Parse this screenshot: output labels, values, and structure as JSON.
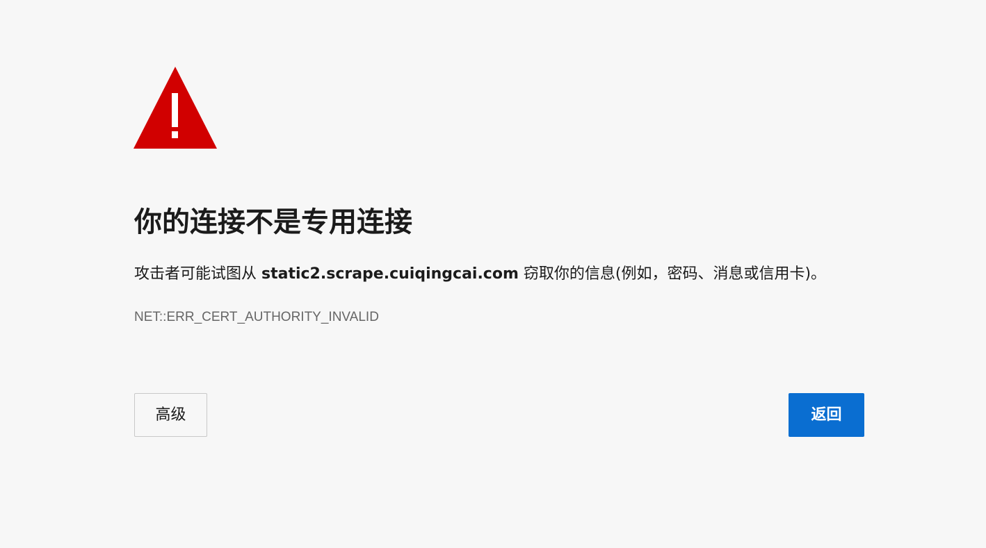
{
  "colors": {
    "background": "#f7f7f7",
    "warning": "#d10000",
    "primary_button": "#0a6ed1",
    "error_code_text": "#666666"
  },
  "icon": {
    "name": "warning-triangle-icon"
  },
  "title": "你的连接不是专用连接",
  "message": {
    "prefix": "攻击者可能试图从 ",
    "host": "static2.scrape.cuiqingcai.com",
    "suffix": " 窃取你的信息(例如，密码、消息或信用卡)。"
  },
  "error_code": "NET::ERR_CERT_AUTHORITY_INVALID",
  "buttons": {
    "advanced_label": "高级",
    "back_label": "返回"
  }
}
